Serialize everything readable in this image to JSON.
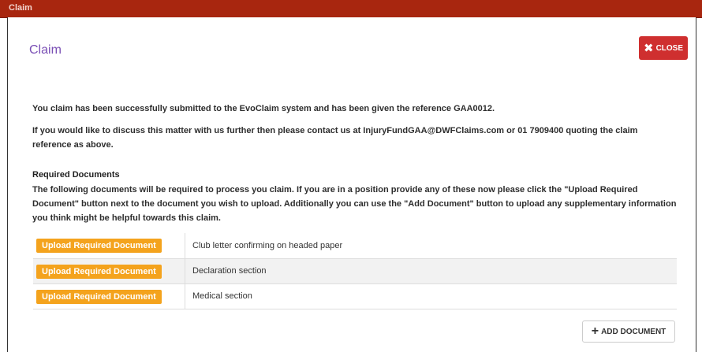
{
  "window": {
    "title": "Claim"
  },
  "dialog": {
    "title": "Claim",
    "close_label": "CLOSE"
  },
  "messages": {
    "success": "You claim has been successfully submitted to the EvoClaim system and has been given the reference GAA0012.",
    "contact": "If you would like to discuss this matter with us further then please contact us at InjuryFundGAA@DWFClaims.com or 01 7909400 quoting the claim reference as above."
  },
  "required_documents": {
    "heading": "Required Documents",
    "description": "The following documents will be required to process you claim. If you are in a position provide any of these now please click the \"Upload Required Document\" button next to the document you wish to upload. Additionally you can use the \"Add Document\" button to upload any supplementary information you think might be helpful towards this claim.",
    "rows": [
      {
        "button_label": "Upload Required Document",
        "document": "Club letter confirming on headed paper"
      },
      {
        "button_label": "Upload Required Document",
        "document": "Declaration section"
      },
      {
        "button_label": "Upload Required Document",
        "document": "Medical section"
      }
    ]
  },
  "footer": {
    "add_document_label": "ADD DOCUMENT"
  },
  "icons": {
    "close": "close-x-icon",
    "add": "plus-icon"
  },
  "colors": {
    "titlebar": "#a8260f",
    "close_button": "#cf2f2f",
    "upload_button": "#f4a31d",
    "dialog_title": "#7a4fb5"
  }
}
